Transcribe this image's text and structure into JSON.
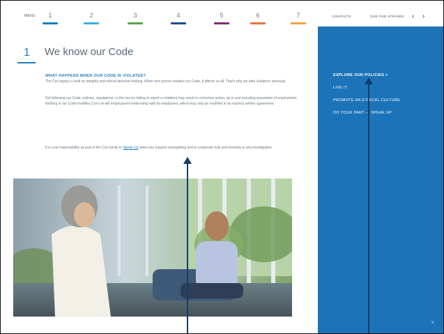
{
  "nav": {
    "menu_label": "MENU",
    "chapters": [
      {
        "number": "1",
        "color": "#1f7bbf"
      },
      {
        "number": "2",
        "color": "#3aaedf"
      },
      {
        "number": "3",
        "color": "#5aa24a"
      },
      {
        "number": "4",
        "color": "#1a4f8a"
      },
      {
        "number": "5",
        "color": "#7a2e7a"
      },
      {
        "number": "6",
        "color": "#e8743a"
      },
      {
        "number": "7",
        "color": "#f0a33a"
      }
    ],
    "contacts_label": "CONTACTS",
    "other_label": "OUR FIVE STRANDS",
    "prev_icon": "chevron-left-icon",
    "next_icon": "chevron-right-icon"
  },
  "content": {
    "chapter_number": "1",
    "title": "We know our Code",
    "subheading": "WHAT HAPPENS WHEN OUR CODE IS VIOLATED?",
    "para1": "The Cox legacy is built on integrity and ethical decision-making. When one person violates our Code, it affects us all. That's why we take violations seriously.",
    "para2": "Not following our Code, policies, regulations, or the law (or failing to report a violation) may result in corrective action, up to and including separation of employment. Nothing in our Code modifies Cox's at-will employment relationship with its employees, which may only be modified in an express written agreement.",
    "para3_before": "It is your responsibility as part of the Cox family to ",
    "para3_link": "Speak Up",
    "para3_after": " when you suspect wrongdoing and to cooperate fully and honestly in any investigation."
  },
  "panel": {
    "items": [
      "EXPLORE OUR POLICIES >",
      "LIVE IT",
      "PROMOTE AN ETHICAL CULTURE",
      "DO YOUR PART — SPEAK UP"
    ],
    "page_number": "9",
    "background": "#1c73b8"
  },
  "colors": {
    "accent": "#1f7bbf",
    "callout": "#123d6b"
  }
}
